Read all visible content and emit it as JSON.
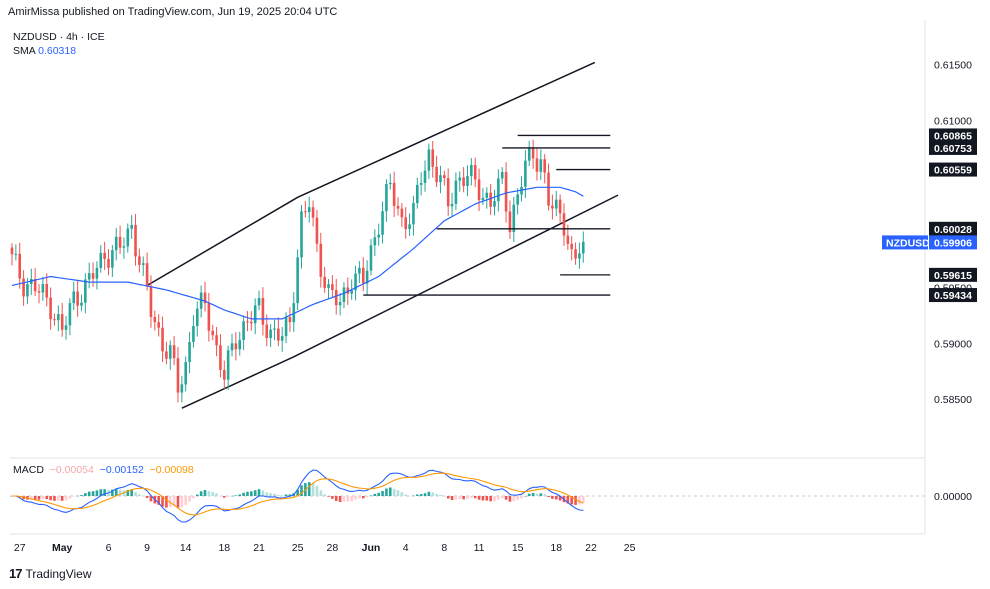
{
  "header": {
    "text": "AmirMissa published on TradingView.com, Jun 19, 2025 20:04 UTC"
  },
  "legend": {
    "symbol": "NZDUSD · 4h · ICE",
    "sma_label": "SMA",
    "sma_value": "0.60318"
  },
  "macd_legend": {
    "label": "MACD",
    "hist": "−0.00054",
    "macd": "−0.00152",
    "signal": "−0.00098"
  },
  "footer": {
    "brand": "TradingView",
    "logo": "17"
  },
  "colors": {
    "up": "#26a69a",
    "down": "#ef5350",
    "sma": "#2962ff",
    "macd_line": "#2962ff",
    "signal_line": "#ff9800",
    "level_label_bg": "#131722",
    "price_label_bg": "#2962ff"
  },
  "chart_data": {
    "type": "candlestick",
    "symbol": "NZDUSD",
    "timeframe": "4h",
    "y_ticks": [
      "0.61500",
      "0.61000",
      "0.59000",
      "0.58500"
    ],
    "y_range": [
      0.58,
      0.619
    ],
    "x_ticks": [
      "27",
      "May",
      "6",
      "9",
      "14",
      "18",
      "21",
      "25",
      "28",
      "Jun",
      "4",
      "8",
      "11",
      "15",
      "18",
      "22",
      "25"
    ],
    "x_tick_bars": [
      2,
      13,
      25,
      35,
      45,
      55,
      64,
      74,
      83,
      93,
      102,
      112,
      121,
      131,
      141,
      150,
      160
    ],
    "price_levels": [
      "0.60865",
      "0.60753",
      "0.60559",
      "0.60028",
      "0.59615",
      "0.59434"
    ],
    "partially_hidden_tick": "0.59500",
    "last_price": {
      "label": "NZDUSD",
      "value": "0.59906"
    },
    "sma_y_label": "0.60318",
    "channel": {
      "upper": [
        [
          35,
          0.5952
        ],
        [
          74,
          0.6031
        ],
        [
          151,
          0.6152
        ]
      ],
      "lower": [
        [
          44,
          0.5842
        ],
        [
          73,
          0.5888
        ],
        [
          157,
          0.6033
        ]
      ]
    },
    "horizontal_segments": [
      {
        "price": 0.60865,
        "from": 131,
        "to": 155
      },
      {
        "price": 0.60753,
        "from": 127,
        "to": 155
      },
      {
        "price": 0.60559,
        "from": 141,
        "to": 155
      },
      {
        "price": 0.60028,
        "from": 110,
        "to": 155
      },
      {
        "price": 0.59615,
        "from": 142,
        "to": 155
      },
      {
        "price": 0.59434,
        "from": 91,
        "to": 155
      }
    ],
    "close_anchors": [
      [
        0,
        0.5975
      ],
      [
        3,
        0.5955
      ],
      [
        6,
        0.595
      ],
      [
        10,
        0.5935
      ],
      [
        13,
        0.591
      ],
      [
        16,
        0.594
      ],
      [
        20,
        0.5955
      ],
      [
        24,
        0.598
      ],
      [
        28,
        0.5985
      ],
      [
        31,
        0.6005
      ],
      [
        33,
        0.5975
      ],
      [
        36,
        0.593
      ],
      [
        39,
        0.59
      ],
      [
        41,
        0.589
      ],
      [
        43,
        0.586
      ],
      [
        45,
        0.588
      ],
      [
        47,
        0.5925
      ],
      [
        50,
        0.5935
      ],
      [
        53,
        0.5895
      ],
      [
        55,
        0.587
      ],
      [
        58,
        0.5905
      ],
      [
        61,
        0.592
      ],
      [
        64,
        0.593
      ],
      [
        67,
        0.591
      ],
      [
        70,
        0.5905
      ],
      [
        72,
        0.592
      ],
      [
        75,
        0.601
      ],
      [
        77,
        0.6025
      ],
      [
        79,
        0.5985
      ],
      [
        82,
        0.5945
      ],
      [
        85,
        0.5935
      ],
      [
        88,
        0.596
      ],
      [
        91,
        0.5955
      ],
      [
        95,
        0.601
      ],
      [
        98,
        0.604
      ],
      [
        101,
        0.601
      ],
      [
        104,
        0.6015
      ],
      [
        106,
        0.605
      ],
      [
        108,
        0.607
      ],
      [
        111,
        0.6045
      ],
      [
        113,
        0.6025
      ],
      [
        115,
        0.6045
      ],
      [
        118,
        0.605
      ],
      [
        121,
        0.604
      ],
      [
        124,
        0.6025
      ],
      [
        127,
        0.6045
      ],
      [
        129,
        0.601
      ],
      [
        131,
        0.603
      ],
      [
        133,
        0.606
      ],
      [
        135,
        0.607
      ],
      [
        137,
        0.6065
      ],
      [
        139,
        0.6025
      ],
      [
        141,
        0.602
      ],
      [
        143,
        0.601
      ],
      [
        144,
        0.5995
      ],
      [
        145,
        0.5975
      ],
      [
        146,
        0.5972
      ],
      [
        147,
        0.5985
      ],
      [
        148,
        0.5991
      ]
    ],
    "sma_anchors": [
      [
        0,
        0.5952
      ],
      [
        10,
        0.596
      ],
      [
        20,
        0.5955
      ],
      [
        30,
        0.5955
      ],
      [
        40,
        0.5948
      ],
      [
        50,
        0.5938
      ],
      [
        55,
        0.593
      ],
      [
        62,
        0.5922
      ],
      [
        70,
        0.5922
      ],
      [
        78,
        0.5935
      ],
      [
        86,
        0.5945
      ],
      [
        95,
        0.596
      ],
      [
        104,
        0.5985
      ],
      [
        112,
        0.601
      ],
      [
        120,
        0.6025
      ],
      [
        128,
        0.6035
      ],
      [
        136,
        0.604
      ],
      [
        142,
        0.604
      ],
      [
        146,
        0.6036
      ],
      [
        148,
        0.6032
      ]
    ],
    "macd_zero_label": "0.00000"
  }
}
